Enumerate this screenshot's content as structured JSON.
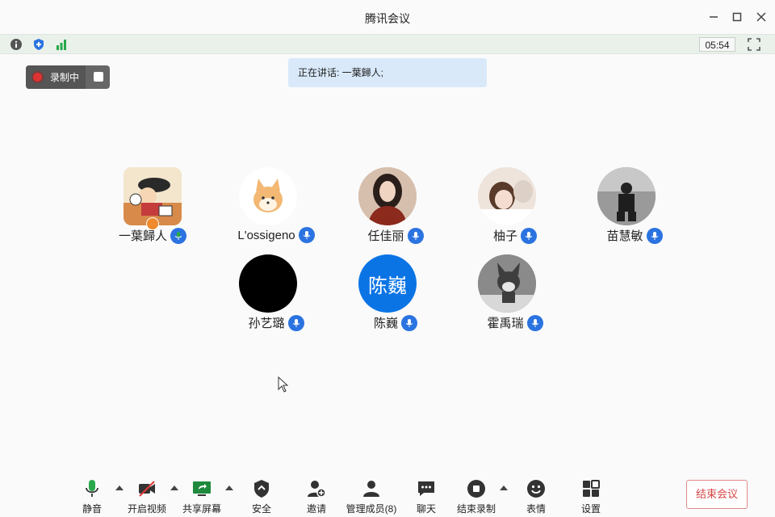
{
  "app": {
    "title": "腾讯会议"
  },
  "status": {
    "timer": "05:54"
  },
  "recording": {
    "label": "录制中"
  },
  "speaking": {
    "text": "正在讲话: 一葉歸人;"
  },
  "participants": [
    {
      "name": "一葉歸人",
      "mic_color": "#2aa84a"
    },
    {
      "name": "L'ossigeno",
      "mic_color": "#2b73e0"
    },
    {
      "name": "任佳丽",
      "mic_color": "#2b73e0"
    },
    {
      "name": "柚子",
      "mic_color": "#2b73e0"
    },
    {
      "name": "苗慧敏",
      "mic_color": "#2b73e0"
    },
    {
      "name": "孙艺璐",
      "mic_color": "#2b73e0"
    },
    {
      "name": "陈巍",
      "avatar_text": "陈巍",
      "mic_color": "#2b73e0"
    },
    {
      "name": "霍禹瑞",
      "mic_color": "#2b73e0"
    }
  ],
  "toolbar": {
    "mute": "静音",
    "video": "开启视频",
    "share": "共享屏幕",
    "security": "安全",
    "invite": "邀请",
    "members": "管理成员(8)",
    "chat": "聊天",
    "end_record": "结束录制",
    "emoji": "表情",
    "settings": "设置",
    "end_meeting": "结束会议"
  },
  "colors": {
    "accent": "#2b73e0",
    "active_mic": "#2aa84a",
    "danger": "#d64545"
  }
}
